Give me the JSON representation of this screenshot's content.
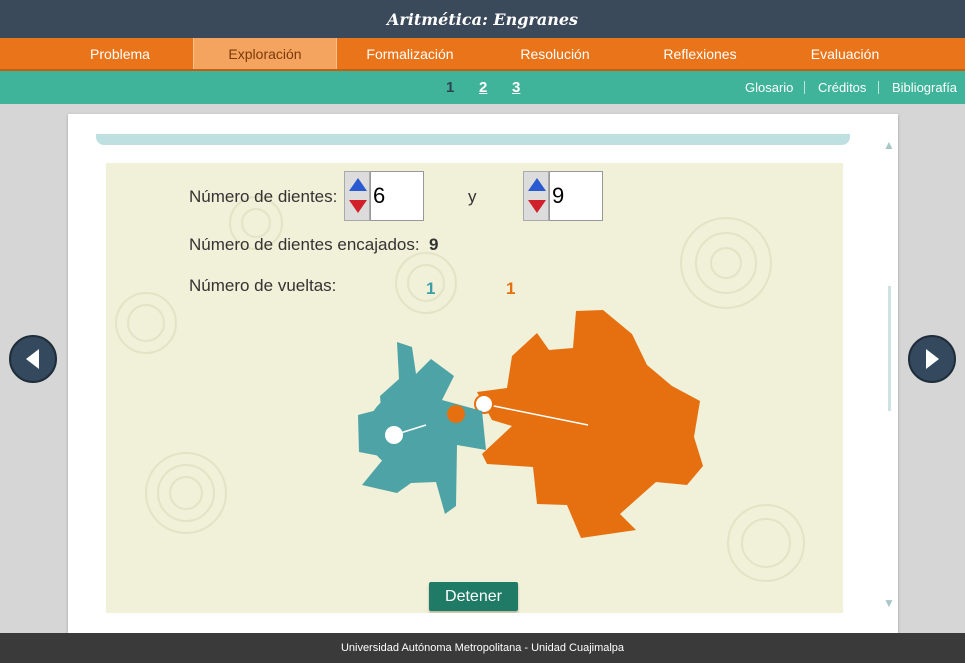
{
  "app": {
    "title": "Aritmética: Engranes"
  },
  "nav": {
    "tabs": [
      "Problema",
      "Exploración",
      "Formalización",
      "Resolución",
      "Reflexiones",
      "Evaluación"
    ],
    "active": "Exploración"
  },
  "subnav": {
    "pages": [
      "1",
      "2",
      "3"
    ],
    "current_page": "1",
    "links": [
      "Glosario",
      "Créditos",
      "Bibliografía"
    ]
  },
  "exploration": {
    "teeth_label": "Número de dientes:",
    "gear1_teeth": "6",
    "conjunction": "y",
    "gear2_teeth": "9",
    "meshed_label": "Número de dientes encajados:",
    "meshed_value": "9",
    "turns_label": "Número de vueltas:",
    "gear1_turns": "1",
    "gear2_turns": "1",
    "stop_button": "Detener"
  },
  "colors": {
    "gear_small": "#4ea3a6",
    "gear_large": "#e6700f",
    "turns_small": "#3e9ea6",
    "turns_large": "#e6700f"
  },
  "footer": {
    "text": "Universidad Autónoma Metropolitana - Unidad Cuajimalpa"
  }
}
